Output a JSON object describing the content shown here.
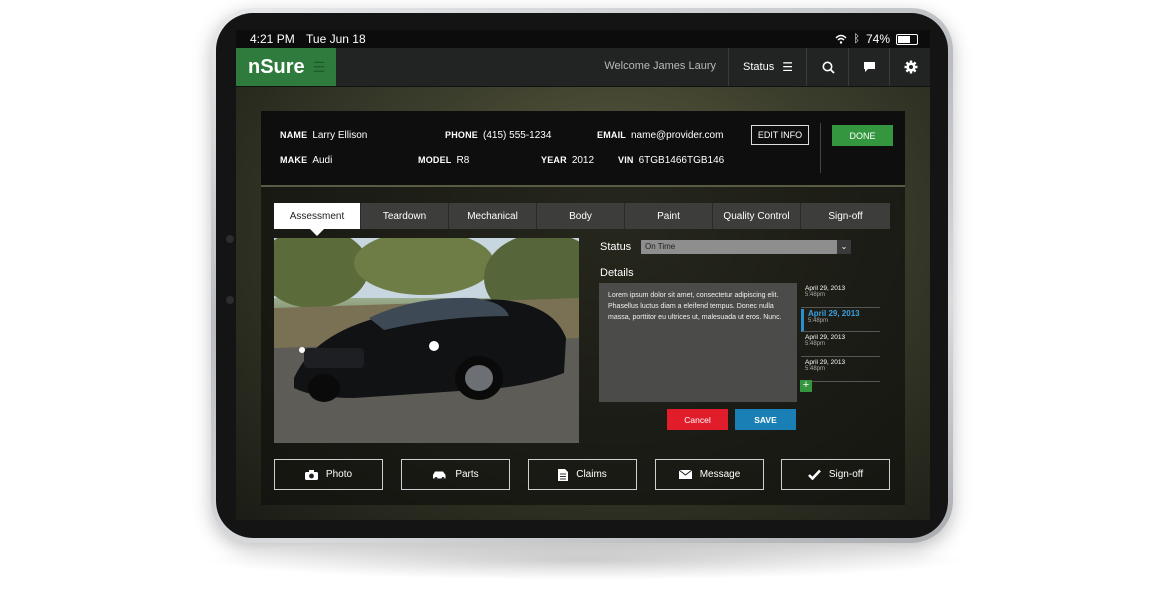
{
  "status_bar": {
    "time": "4:21 PM",
    "date": "Tue Jun 18",
    "battery": "74%",
    "battery_level": 0.74
  },
  "nav": {
    "logo": "nSure",
    "welcome": "Welcome James Laury",
    "status_label": "Status",
    "icons": [
      "menu-icon",
      "search-icon",
      "chat-icon",
      "gear-icon"
    ]
  },
  "customer": {
    "name_label": "NAME",
    "name": "Larry Ellison",
    "phone_label": "PHONE",
    "phone": "(415) 555-1234",
    "email_label": "EMAIL",
    "email": "name@provider.com",
    "make_label": "MAKE",
    "make": "Audi",
    "model_label": "MODEL",
    "model": "R8",
    "year_label": "YEAR",
    "year": "2012",
    "vin_label": "VIN",
    "vin": "6TGB1466TGB146",
    "edit_label": "EDIT INFO",
    "done_label": "DONE"
  },
  "tabs": [
    {
      "label": "Assessment",
      "active": true
    },
    {
      "label": "Teardown"
    },
    {
      "label": "Mechanical"
    },
    {
      "label": "Body"
    },
    {
      "label": "Paint"
    },
    {
      "label": "Quality Control"
    },
    {
      "label": "Sign-off"
    }
  ],
  "assessment": {
    "status_label": "Status",
    "status_value": "On Time",
    "details_label": "Details",
    "details_text": "Lorem ipsum dolor sit amet, consectetur adipiscing elit. Phasellus luctus diam a eleifend tempus. Donec nulla massa, porttitor eu ultrices ut, malesuada ut eros. Nunc.",
    "history": [
      {
        "date": "April 29, 2013",
        "time": "5:48pm"
      },
      {
        "date": "April 29, 2013",
        "time": "5:48pm",
        "selected": true
      },
      {
        "date": "April 29, 2013",
        "time": "5:48pm"
      },
      {
        "date": "April 29, 2013",
        "time": "5:48pm"
      }
    ],
    "add_label": "+",
    "cancel_label": "Cancel",
    "save_label": "SAVE"
  },
  "actions": [
    {
      "label": "Photo",
      "icon": "camera-icon"
    },
    {
      "label": "Parts",
      "icon": "car-icon"
    },
    {
      "label": "Claims",
      "icon": "document-icon"
    },
    {
      "label": "Message",
      "icon": "envelope-icon"
    },
    {
      "label": "Sign-off",
      "icon": "checkmark-icon"
    }
  ],
  "colors": {
    "brand_green": "#2f7a3d",
    "done_green": "#34973f",
    "cancel_red": "#e11d2b",
    "save_blue": "#1a7fb4",
    "accent_blue": "#3aa0e0"
  }
}
